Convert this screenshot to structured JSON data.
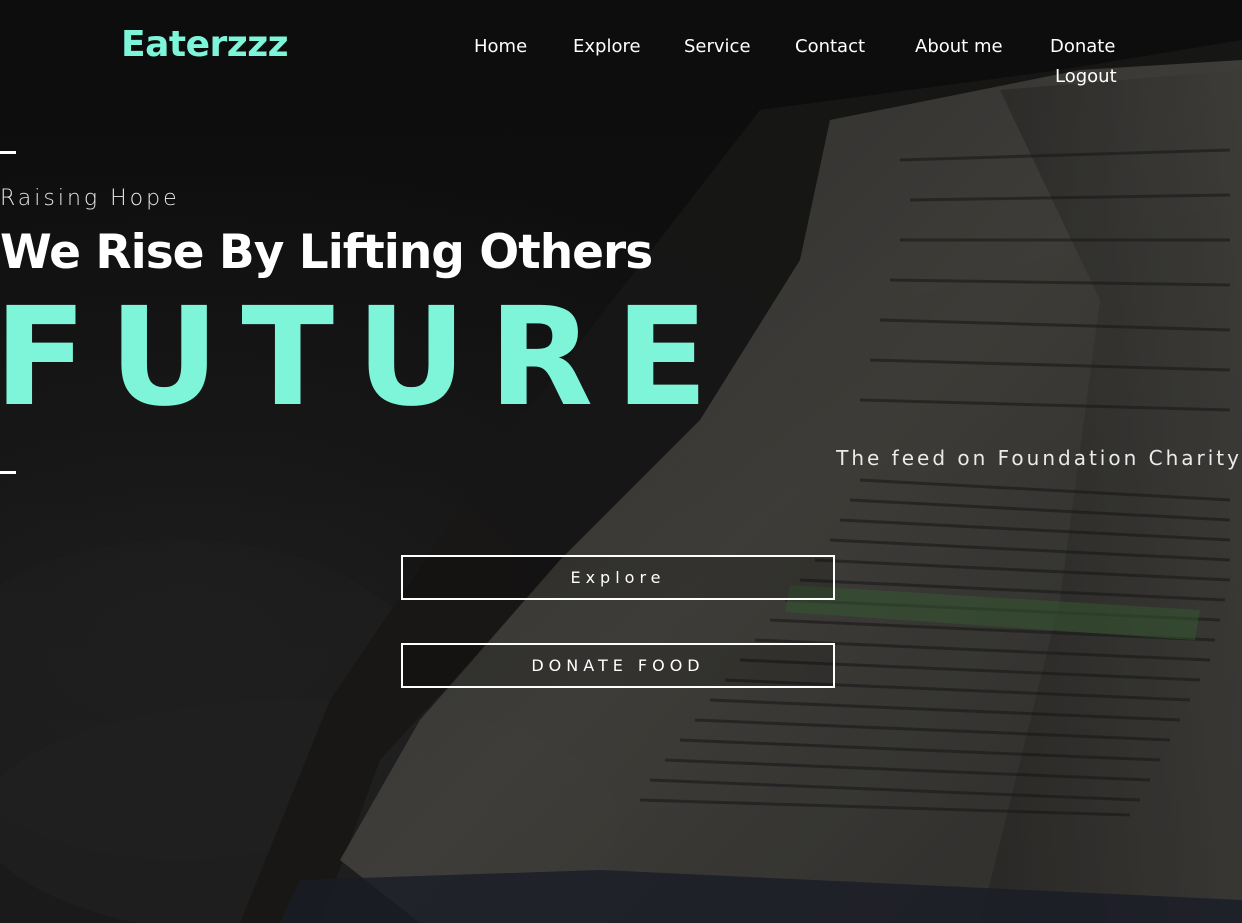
{
  "brand": "Eaterzzz",
  "nav": {
    "items": [
      "Home",
      "Explore",
      "Service",
      "Contact",
      "About me",
      "Donate",
      "Logout"
    ]
  },
  "hero": {
    "kicker": "Raising Hope",
    "headline": "We Rise By Lifting Others",
    "big_word": "FUTURE",
    "tagline": "The feed on Foundation Charity"
  },
  "buttons": {
    "explore": "Explore",
    "donate_food": "DONATE FOOD"
  },
  "colors": {
    "accent": "#7ef4d9",
    "text": "#ffffff",
    "background": "#0f0f10"
  }
}
